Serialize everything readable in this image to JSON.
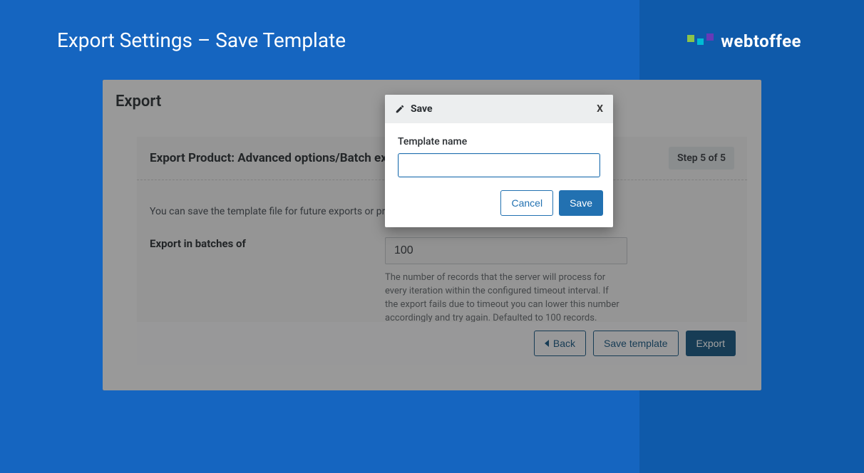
{
  "page": {
    "title": "Export Settings – Save Template"
  },
  "brand": {
    "name": "webtoffee",
    "squares": [
      "#8bc34a",
      "#00bcd4",
      "#673ab7"
    ]
  },
  "app": {
    "heading": "Export",
    "step": {
      "title": "Export Product: Advanced options/Batch export",
      "badge": "Step 5 of 5",
      "description": "You can save the template file for future exports or proceed with the export.",
      "batch_label": "Export in batches of",
      "batch_value": "100",
      "batch_help": "The number of records that the server will process for every iteration within the configured timeout interval. If the export fails due to timeout you can lower this number accordingly and try again. Defaulted to 100 records."
    },
    "actions": {
      "back": "Back",
      "save_template": "Save template",
      "export": "Export"
    }
  },
  "modal": {
    "title": "Save",
    "close": "X",
    "field_label": "Template name",
    "field_value": "",
    "cancel": "Cancel",
    "save": "Save"
  }
}
